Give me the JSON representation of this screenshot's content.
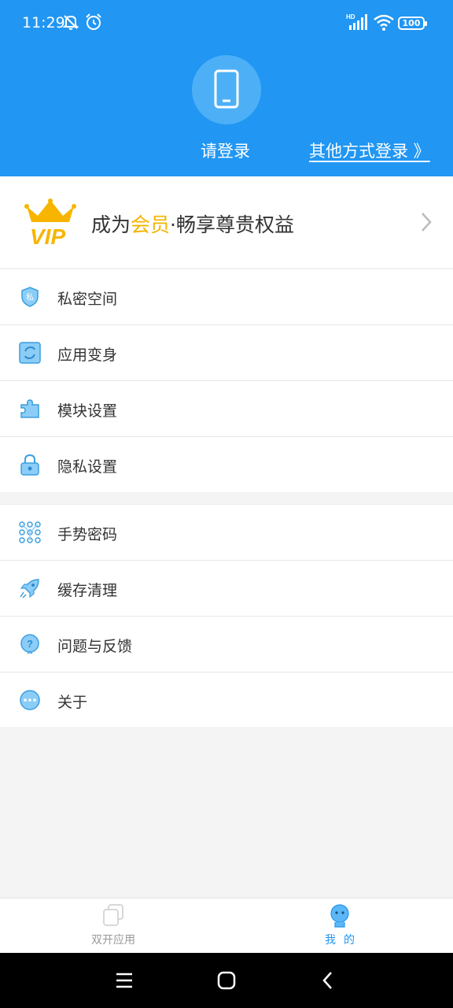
{
  "status_bar": {
    "time": "11:29",
    "battery": "100",
    "icons": [
      "mute-icon",
      "alarm-icon",
      "hd-signal-icon",
      "wifi-icon",
      "battery-icon"
    ]
  },
  "header": {
    "login_label": "请登录",
    "other_login_label": "其他方式登录 》",
    "avatar_icon": "phone-icon",
    "background_color": "#2196f3"
  },
  "vip": {
    "badge_text": "VIP",
    "title_prefix": "成为",
    "title_highlight": "会员",
    "title_suffix": "·畅享尊贵权益",
    "highlight_color": "#f2b400"
  },
  "menu_group_1": [
    {
      "label": "私密空间",
      "icon": "private-shield-icon",
      "icon_text": "私"
    },
    {
      "label": "应用变身",
      "icon": "app-transform-icon"
    },
    {
      "label": "模块设置",
      "icon": "puzzle-icon"
    },
    {
      "label": "隐私设置",
      "icon": "lock-icon"
    }
  ],
  "menu_group_2": [
    {
      "label": "手势密码",
      "icon": "gesture-grid-icon"
    },
    {
      "label": "缓存清理",
      "icon": "rocket-icon"
    },
    {
      "label": "问题与反馈",
      "icon": "question-bubble-icon"
    },
    {
      "label": "关于",
      "icon": "more-dots-icon"
    }
  ],
  "tabbar": {
    "tabs": [
      {
        "label": "双开应用",
        "icon": "dual-app-icon",
        "active": false
      },
      {
        "label": "我的",
        "icon": "mascot-icon",
        "active": true
      }
    ],
    "active_color": "#2196f3"
  }
}
